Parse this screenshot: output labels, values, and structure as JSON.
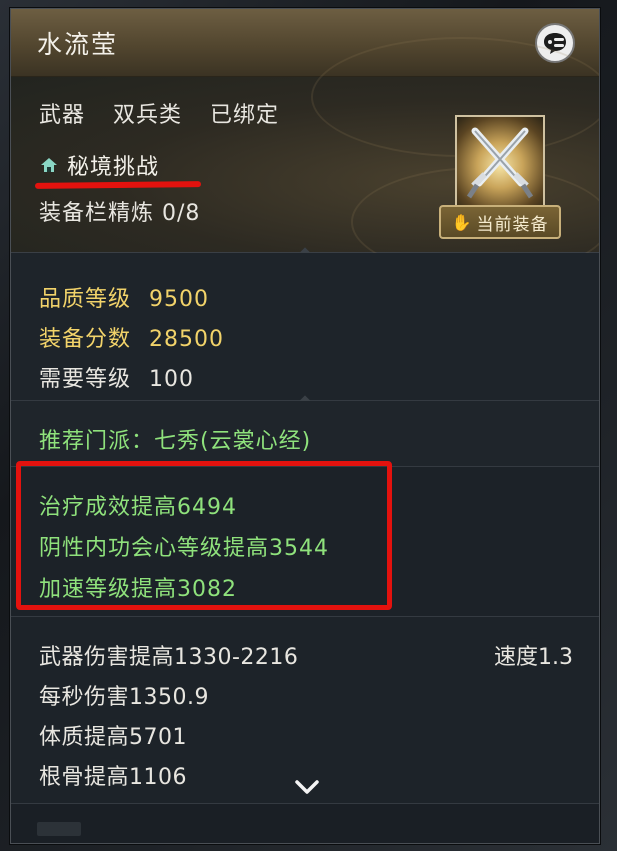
{
  "item": {
    "name": "水流莹",
    "tags": [
      "武器",
      "双兵类",
      "已绑定"
    ],
    "source": "秘境挑战",
    "refine": "装备栏精炼 0/8",
    "equipped_badge": "当前装备"
  },
  "stats": {
    "quality_label": "品质等级",
    "quality_value": "9500",
    "score_label": "装备分数",
    "score_value": "28500",
    "level_label": "需要等级",
    "level_value": "100"
  },
  "recommend": "推荐门派：七秀(云裳心经)",
  "attributes": [
    "治疗成效提高6494",
    "阴性内功会心等级提高3544",
    "加速等级提高3082"
  ],
  "base": {
    "damage": "武器伤害提高1330-2216",
    "speed": "速度1.3",
    "dps": "每秒伤害1350.9",
    "constitution": "体质提高5701",
    "spirit": "根骨提高1106"
  },
  "colors": {
    "gold_text": "#f2d36a",
    "green_text": "#8fe27c",
    "highlight_red": "#e3120e"
  },
  "icons": {
    "chat": "chat-bubble-icon",
    "source": "house-icon",
    "item": "crossed-blades-icon",
    "scroll": "chevron-down-icon"
  }
}
